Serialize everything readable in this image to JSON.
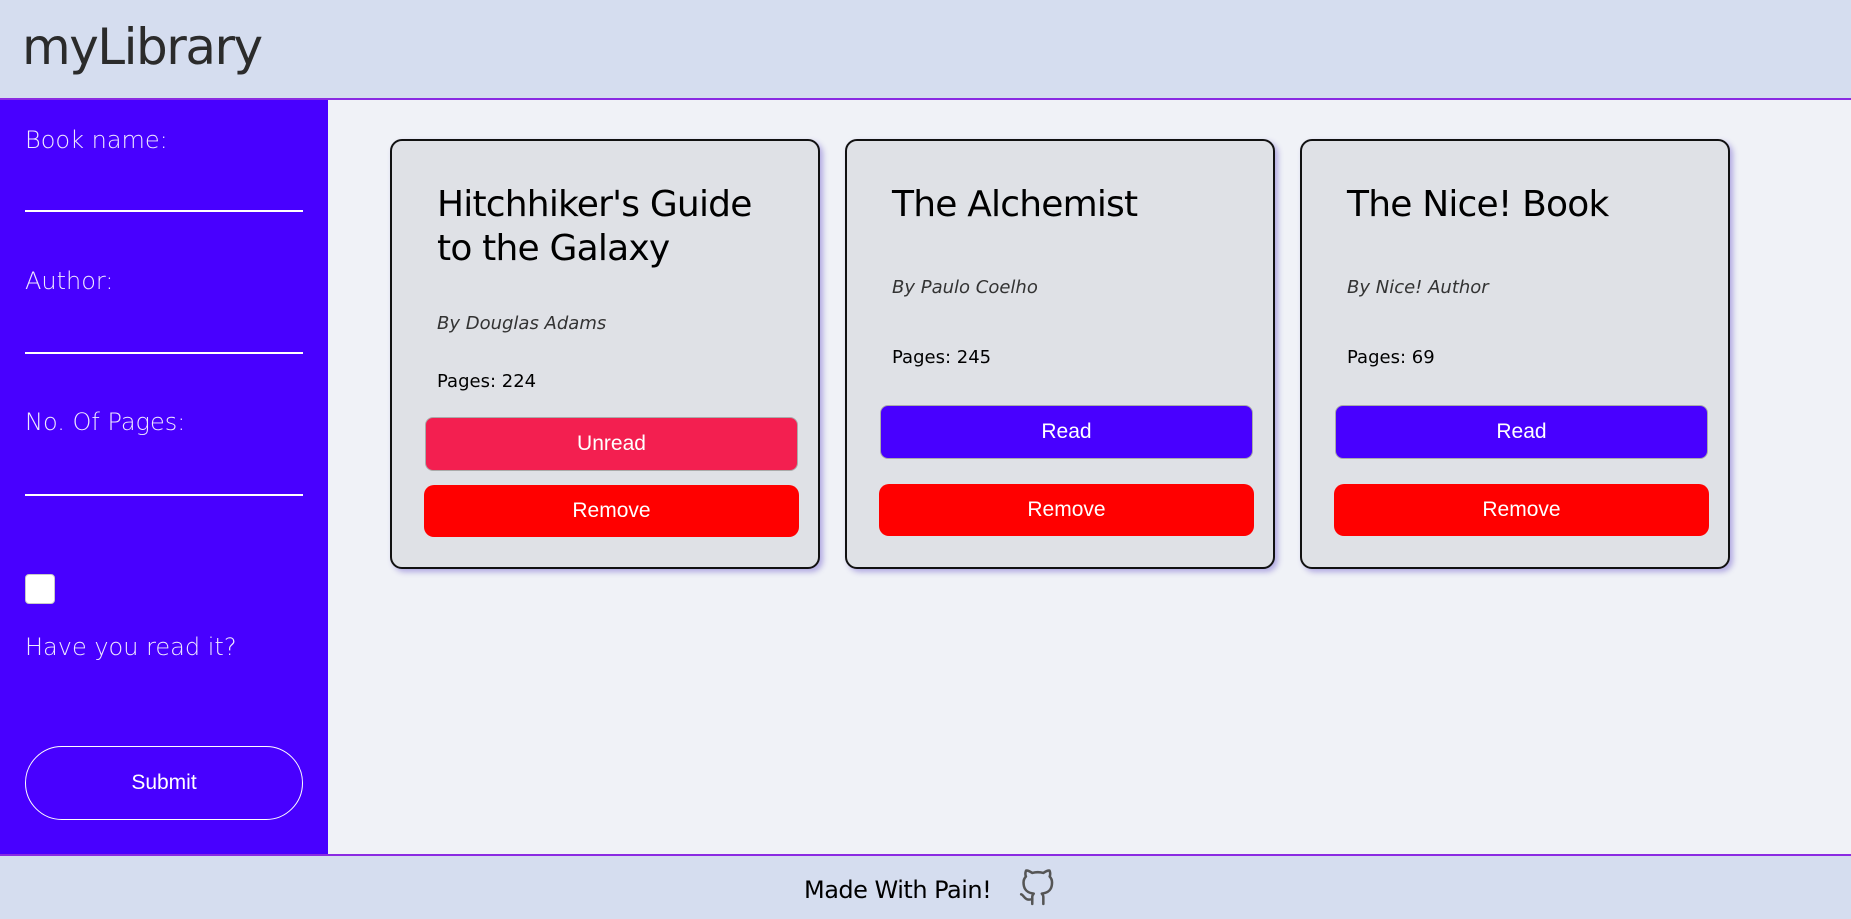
{
  "header": {
    "title": "myLibrary"
  },
  "sidebar": {
    "book_name_label": "Book name:",
    "author_label": "Author:",
    "pages_label": "No. Of Pages:",
    "read_label": "Have you read it?",
    "read_checked": false,
    "submit_label": "Submit",
    "accent_color": "#4800ff"
  },
  "books": [
    {
      "title": "Hitchhiker's Guide to the Galaxy",
      "author": "By Douglas Adams",
      "pages": "Pages: 224",
      "status_label": "Unread",
      "status_color": "#f31f50",
      "remove_label": "Remove"
    },
    {
      "title": "The Alchemist",
      "author": "By Paulo Coelho",
      "pages": "Pages: 245",
      "status_label": "Read",
      "status_color": "#4800ff",
      "remove_label": "Remove"
    },
    {
      "title": "The Nice! Book",
      "author": "By Nice! Author",
      "pages": "Pages: 69",
      "status_label": "Read",
      "status_color": "#4800ff",
      "remove_label": "Remove"
    }
  ],
  "footer": {
    "text": "Made With Pain!",
    "icon": "github-icon"
  }
}
